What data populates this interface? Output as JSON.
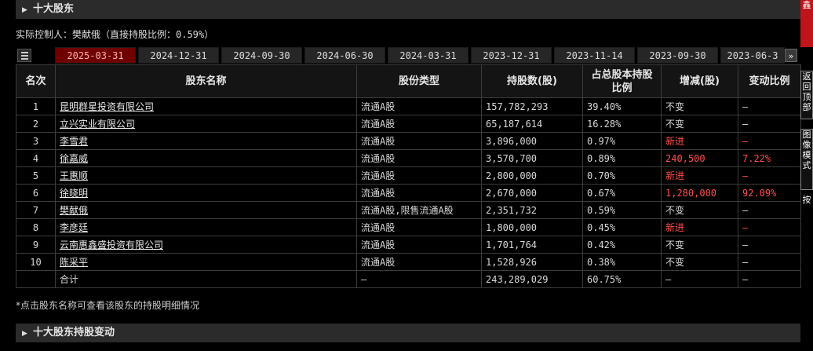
{
  "top_section": {
    "title": "十大股东"
  },
  "controller": "实际控制人：樊献俄（直接持股比例：0.59%）",
  "tabs": [
    "2025-03-31",
    "2024-12-31",
    "2024-09-30",
    "2024-06-30",
    "2024-03-31",
    "2023-12-31",
    "2023-11-14",
    "2023-09-30",
    "2023-06-3"
  ],
  "active_tab": 0,
  "table": {
    "headers": {
      "rank": "名次",
      "name": "股东名称",
      "type": "股份类型",
      "shares": "持股数(股)",
      "ratio": "占总股本持股比例",
      "change": "增减(股)",
      "change_ratio": "变动比例"
    },
    "rows": [
      {
        "rank": "1",
        "name": "昆明群星投资有限公司",
        "type": "流通A股",
        "shares": "157,782,293",
        "ratio": "39.40%",
        "change": "不变",
        "change_ratio": "—"
      },
      {
        "rank": "2",
        "name": "立兴实业有限公司",
        "type": "流通A股",
        "shares": "65,187,614",
        "ratio": "16.28%",
        "change": "不变",
        "change_ratio": "—"
      },
      {
        "rank": "3",
        "name": "李雪君",
        "type": "流通A股",
        "shares": "3,896,000",
        "ratio": "0.97%",
        "change": "新进",
        "change_ratio": "—"
      },
      {
        "rank": "4",
        "name": "徐嘉威",
        "type": "流通A股",
        "shares": "3,570,700",
        "ratio": "0.89%",
        "change": "240,500",
        "change_ratio": "7.22%"
      },
      {
        "rank": "5",
        "name": "王惠顺",
        "type": "流通A股",
        "shares": "2,800,000",
        "ratio": "0.70%",
        "change": "新进",
        "change_ratio": "—"
      },
      {
        "rank": "6",
        "name": "徐晓明",
        "type": "流通A股",
        "shares": "2,670,000",
        "ratio": "0.67%",
        "change": "1,280,000",
        "change_ratio": "92.09%"
      },
      {
        "rank": "7",
        "name": "樊献俄",
        "type": "流通A股,限售流通A股",
        "shares": "2,351,732",
        "ratio": "0.59%",
        "change": "不变",
        "change_ratio": "—"
      },
      {
        "rank": "8",
        "name": "李彦廷",
        "type": "流通A股",
        "shares": "1,800,000",
        "ratio": "0.45%",
        "change": "新进",
        "change_ratio": "—"
      },
      {
        "rank": "9",
        "name": "云南惠鑫盛投资有限公司",
        "type": "流通A股",
        "shares": "1,701,764",
        "ratio": "0.42%",
        "change": "不变",
        "change_ratio": "—"
      },
      {
        "rank": "10",
        "name": "陈采平",
        "type": "流通A股",
        "shares": "1,528,926",
        "ratio": "0.38%",
        "change": "不变",
        "change_ratio": "—"
      }
    ],
    "total": {
      "label": "合计",
      "type": "—",
      "shares": "243,289,029",
      "ratio": "60.75%",
      "change": "—",
      "change_ratio": "—"
    }
  },
  "note": "*点击股东名称可查看该股东的持股明细情况",
  "bottom_section": {
    "title": "十大股东持股变动"
  },
  "side_tabs": {
    "red": "鑫",
    "b1": "返回顶部",
    "b2": "图像模式",
    "t": "按"
  },
  "colors": {
    "increase": "#ff4d4d",
    "active_tab_bg": "#6e0000",
    "side_red": "#c0141a"
  },
  "icons": {
    "section_toggle": "triangle-right-icon",
    "menu": "menu-icon",
    "next": "double-chevron-right-icon"
  }
}
